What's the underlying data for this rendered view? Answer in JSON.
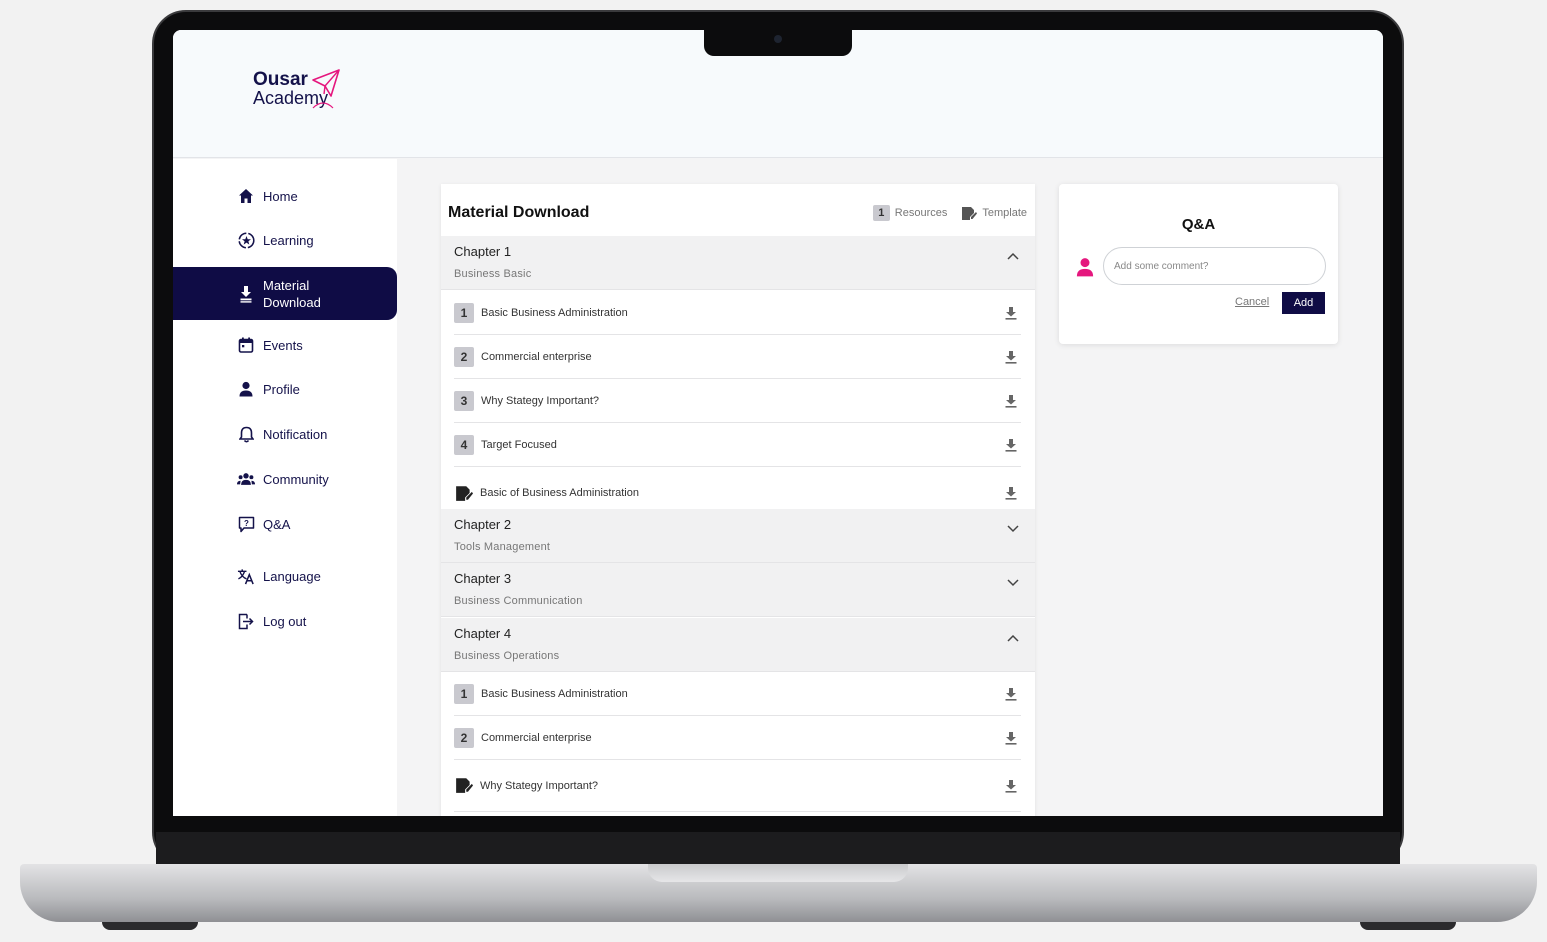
{
  "logo": {
    "line1": "Ousar",
    "line2": "Academy"
  },
  "sidebar": {
    "items": [
      {
        "label": "Home"
      },
      {
        "label": "Learning"
      },
      {
        "label": "Material\nDownload"
      },
      {
        "label": "Events"
      },
      {
        "label": "Profile"
      },
      {
        "label": "Notification"
      },
      {
        "label": "Community"
      },
      {
        "label": "Q&A"
      },
      {
        "label": "Language"
      },
      {
        "label": "Log out"
      }
    ]
  },
  "main": {
    "title": "Material Download",
    "legend": {
      "resources_badge": "1",
      "resources_label": "Resources",
      "template_label": "Template"
    },
    "chapters": [
      {
        "title": "Chapter 1",
        "subtitle": "Business Basic",
        "items": [
          {
            "num": "1",
            "label": "Basic  Business Administration"
          },
          {
            "num": "2",
            "label": "Commercial enterprise"
          },
          {
            "num": "3",
            "label": "Why Stategy Important?"
          },
          {
            "num": "4",
            "label": "Target Focused"
          },
          {
            "num": "",
            "label": "Basic of Business Administration"
          }
        ]
      },
      {
        "title": "Chapter 2",
        "subtitle": "Tools Management",
        "items": []
      },
      {
        "title": "Chapter 3",
        "subtitle": "Business Communication",
        "items": []
      },
      {
        "title": "Chapter 4",
        "subtitle": "Business Operations",
        "items": [
          {
            "num": "1",
            "label": "Basic  Business Administration"
          },
          {
            "num": "2",
            "label": "Commercial enterprise"
          },
          {
            "num": "",
            "label": "Why Stategy Important?"
          }
        ]
      }
    ]
  },
  "qa": {
    "title": "Q&A",
    "input_placeholder": "Add some comment?",
    "cancel_label": "Cancel",
    "add_label": "Add"
  },
  "colors": {
    "brand": "#0f0c45",
    "accent": "#e5177e"
  }
}
